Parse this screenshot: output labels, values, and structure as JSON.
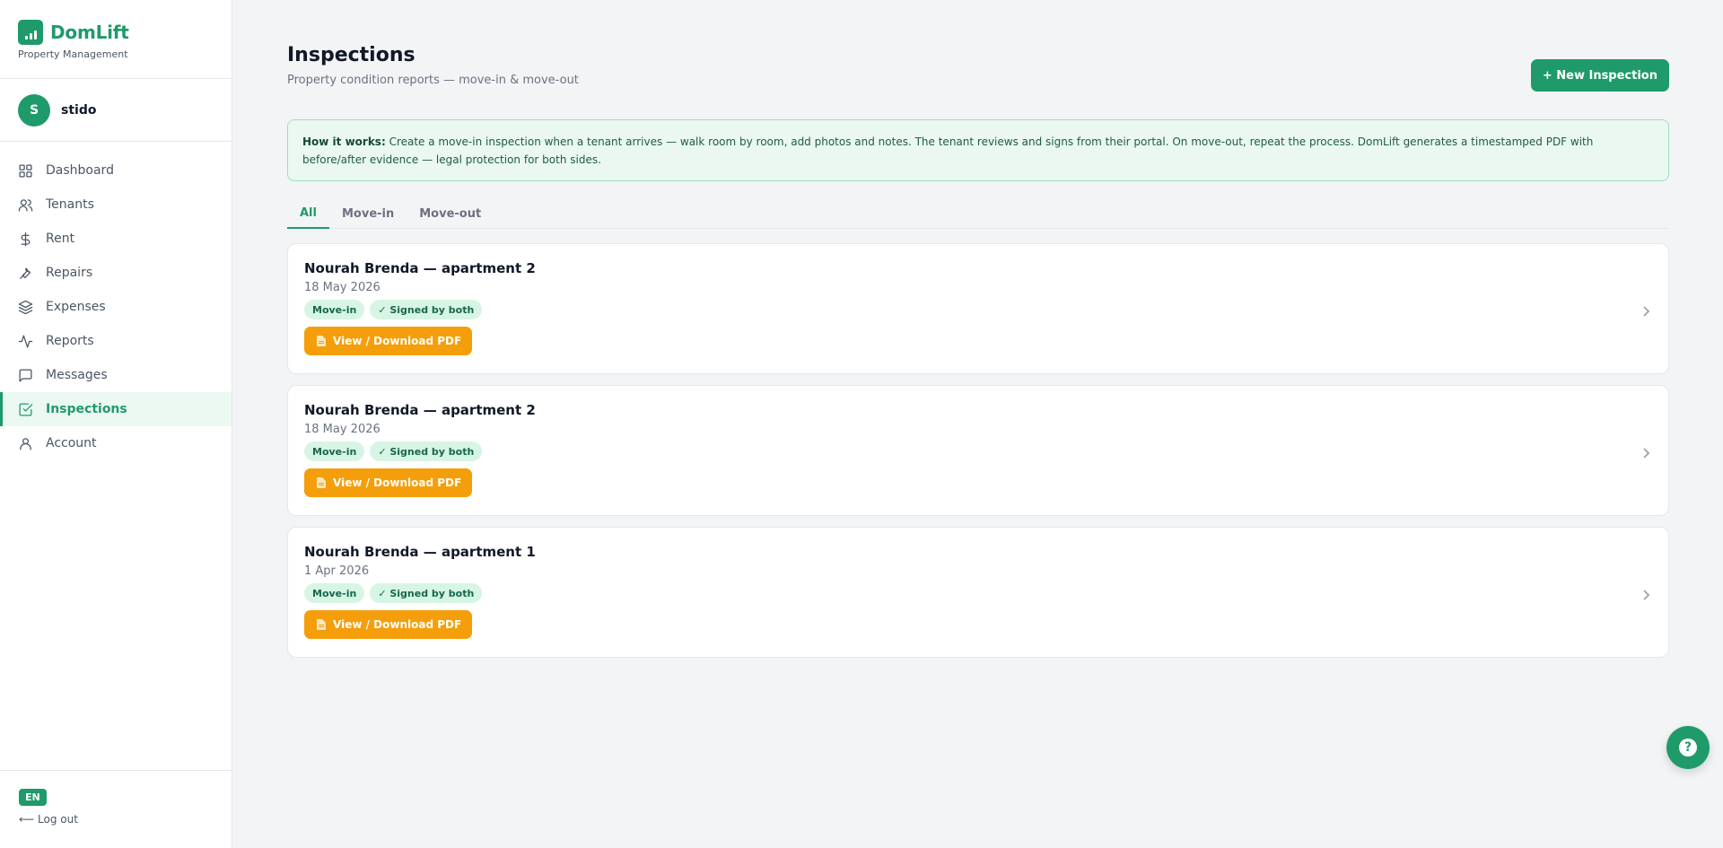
{
  "brand": {
    "name": "DomLift",
    "subtitle": "Property Management"
  },
  "user": {
    "initial": "S",
    "name": "stido"
  },
  "nav": [
    {
      "label": "Dashboard",
      "icon": "grid-icon",
      "active": false
    },
    {
      "label": "Tenants",
      "icon": "users-icon",
      "active": false
    },
    {
      "label": "Rent",
      "icon": "dollar-icon",
      "active": false
    },
    {
      "label": "Repairs",
      "icon": "wrench-icon",
      "active": false
    },
    {
      "label": "Expenses",
      "icon": "layers-icon",
      "active": false
    },
    {
      "label": "Reports",
      "icon": "activity-icon",
      "active": false
    },
    {
      "label": "Messages",
      "icon": "message-icon",
      "active": false
    },
    {
      "label": "Inspections",
      "icon": "check-square-icon",
      "active": true
    },
    {
      "label": "Account",
      "icon": "user-icon",
      "active": false
    }
  ],
  "footer": {
    "language": "EN",
    "logout": "⟵ Log out"
  },
  "page": {
    "title": "Inspections",
    "subtitle": "Property condition reports — move-in & move-out",
    "new_button": "+ New Inspection"
  },
  "info": {
    "lead": "How it works:",
    "text": " Create a move-in inspection when a tenant arrives — walk room by room, add photos and notes. The tenant reviews and signs from their portal. On move-out, repeat the process. DomLift generates a timestamped PDF with before/after evidence — legal protection for both sides."
  },
  "tabs": [
    {
      "label": "All",
      "active": true
    },
    {
      "label": "Move-in",
      "active": false
    },
    {
      "label": "Move-out",
      "active": false
    }
  ],
  "inspections": [
    {
      "title": "Nourah Brenda — apartment 2",
      "date": "18 May 2026",
      "type": "Move-in",
      "status": "✓ Signed by both",
      "action": "View / Download PDF"
    },
    {
      "title": "Nourah Brenda — apartment 2",
      "date": "18 May 2026",
      "type": "Move-in",
      "status": "✓ Signed by both",
      "action": "View / Download PDF"
    },
    {
      "title": "Nourah Brenda — apartment 1",
      "date": "1 Apr 2026",
      "type": "Move-in",
      "status": "✓ Signed by both",
      "action": "View / Download PDF"
    }
  ],
  "help": {
    "symbol": "?"
  },
  "colors": {
    "accent": "#1f9a6b",
    "warning": "#f59e0b",
    "badge_bg": "#d7f5e5"
  }
}
